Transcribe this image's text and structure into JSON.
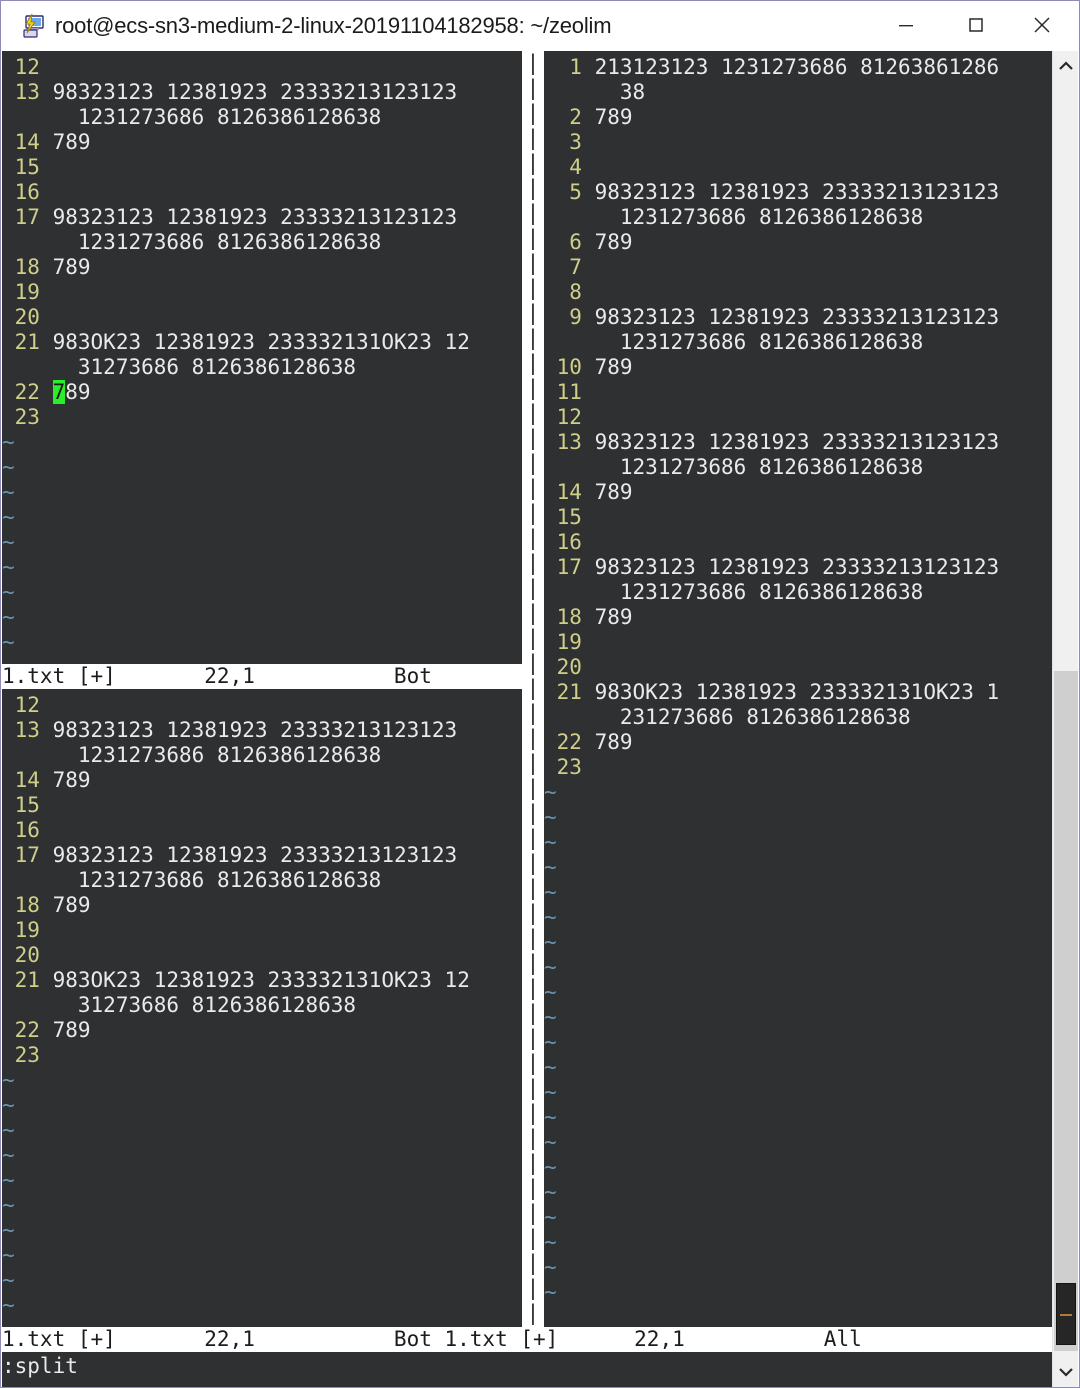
{
  "window": {
    "title": "root@ecs-sn3-medium-2-linux-20191104182958: ~/zeolim",
    "icon": "putty-icon",
    "controls": {
      "minimize": "minimize-icon",
      "maximize": "maximize-icon",
      "close": "close-icon"
    }
  },
  "editor": {
    "app": "vim",
    "command_line": ":split",
    "cursor": {
      "line": 22,
      "col": 1,
      "char": "7",
      "color": "#2bee2b"
    },
    "colors": {
      "background": "#2f3031",
      "foreground": "#eaeaea",
      "line_number": "#cfcf8a",
      "tilde": "#6a93b0",
      "statusline_bg": "#ffffff",
      "statusline_fg": "#1c1c1c"
    },
    "separator_char": "|"
  },
  "panes": [
    {
      "id": "top-left",
      "status": {
        "file": "1.txt",
        "modified": "[+]",
        "position": "22,1",
        "scroll": "Bot"
      },
      "rows": [
        {
          "num": "12",
          "text": ""
        },
        {
          "num": "13",
          "text": "98323123 12381923 23333213123123"
        },
        {
          "num": "",
          "text": "1231273686 8126386128638",
          "cont": true
        },
        {
          "num": "14",
          "text": "789"
        },
        {
          "num": "15",
          "text": ""
        },
        {
          "num": "16",
          "text": ""
        },
        {
          "num": "17",
          "text": "98323123 12381923 23333213123123"
        },
        {
          "num": "",
          "text": "1231273686 8126386128638",
          "cont": true
        },
        {
          "num": "18",
          "text": "789"
        },
        {
          "num": "19",
          "text": ""
        },
        {
          "num": "20",
          "text": ""
        },
        {
          "num": "21",
          "text": "983OK23 12381923 233332131OK23 12"
        },
        {
          "num": "",
          "text": "31273686 8126386128638",
          "cont": true
        },
        {
          "num": "22",
          "text": "789",
          "cursor": true
        },
        {
          "num": "23",
          "text": ""
        },
        {
          "num": "~",
          "text": ""
        },
        {
          "num": "~",
          "text": ""
        },
        {
          "num": "~",
          "text": ""
        },
        {
          "num": "~",
          "text": ""
        },
        {
          "num": "~",
          "text": ""
        },
        {
          "num": "~",
          "text": ""
        },
        {
          "num": "~",
          "text": ""
        },
        {
          "num": "~",
          "text": ""
        },
        {
          "num": "~",
          "text": ""
        },
        {
          "num": "~",
          "text": ""
        }
      ]
    },
    {
      "id": "bottom-left",
      "status": {
        "file": "1.txt",
        "modified": "[+]",
        "position": "22,1",
        "scroll": "Bot"
      },
      "rows": [
        {
          "num": "12",
          "text": ""
        },
        {
          "num": "13",
          "text": "98323123 12381923 23333213123123"
        },
        {
          "num": "",
          "text": "1231273686 8126386128638",
          "cont": true
        },
        {
          "num": "14",
          "text": "789"
        },
        {
          "num": "15",
          "text": ""
        },
        {
          "num": "16",
          "text": ""
        },
        {
          "num": "17",
          "text": "98323123 12381923 23333213123123"
        },
        {
          "num": "",
          "text": "1231273686 8126386128638",
          "cont": true
        },
        {
          "num": "18",
          "text": "789"
        },
        {
          "num": "19",
          "text": ""
        },
        {
          "num": "20",
          "text": ""
        },
        {
          "num": "21",
          "text": "983OK23 12381923 233332131OK23 12"
        },
        {
          "num": "",
          "text": "31273686 8126386128638",
          "cont": true
        },
        {
          "num": "22",
          "text": "789"
        },
        {
          "num": "23",
          "text": ""
        },
        {
          "num": "~",
          "text": ""
        },
        {
          "num": "~",
          "text": ""
        },
        {
          "num": "~",
          "text": ""
        },
        {
          "num": "~",
          "text": ""
        },
        {
          "num": "~",
          "text": ""
        },
        {
          "num": "~",
          "text": ""
        },
        {
          "num": "~",
          "text": ""
        },
        {
          "num": "~",
          "text": ""
        },
        {
          "num": "~",
          "text": ""
        },
        {
          "num": "~",
          "text": ""
        }
      ]
    },
    {
      "id": "right",
      "status": {
        "file": "1.txt",
        "modified": "[+]",
        "position": "22,1",
        "scroll": "All"
      },
      "rows": [
        {
          "num": " 1",
          "text": "213123123 1231273686 81263861286"
        },
        {
          "num": "",
          "text": "38",
          "cont": true
        },
        {
          "num": " 2",
          "text": "789"
        },
        {
          "num": " 3",
          "text": ""
        },
        {
          "num": " 4",
          "text": ""
        },
        {
          "num": " 5",
          "text": "98323123 12381923 23333213123123"
        },
        {
          "num": "",
          "text": "1231273686 8126386128638",
          "cont": true
        },
        {
          "num": " 6",
          "text": "789"
        },
        {
          "num": " 7",
          "text": ""
        },
        {
          "num": " 8",
          "text": ""
        },
        {
          "num": " 9",
          "text": "98323123 12381923 23333213123123"
        },
        {
          "num": "",
          "text": "1231273686 8126386128638",
          "cont": true
        },
        {
          "num": "10",
          "text": "789"
        },
        {
          "num": "11",
          "text": ""
        },
        {
          "num": "12",
          "text": ""
        },
        {
          "num": "13",
          "text": "98323123 12381923 23333213123123"
        },
        {
          "num": "",
          "text": "1231273686 8126386128638",
          "cont": true
        },
        {
          "num": "14",
          "text": "789"
        },
        {
          "num": "15",
          "text": ""
        },
        {
          "num": "16",
          "text": ""
        },
        {
          "num": "17",
          "text": "98323123 12381923 23333213123123"
        },
        {
          "num": "",
          "text": "1231273686 8126386128638",
          "cont": true
        },
        {
          "num": "18",
          "text": "789"
        },
        {
          "num": "19",
          "text": ""
        },
        {
          "num": "20",
          "text": ""
        },
        {
          "num": "21",
          "text": "983OK23 12381923 233332131OK23 1"
        },
        {
          "num": "",
          "text": "231273686 8126386128638",
          "cont": true
        },
        {
          "num": "22",
          "text": "789"
        },
        {
          "num": "23",
          "text": ""
        },
        {
          "num": "~",
          "text": ""
        },
        {
          "num": "~",
          "text": ""
        },
        {
          "num": "~",
          "text": ""
        },
        {
          "num": "~",
          "text": ""
        },
        {
          "num": "~",
          "text": ""
        },
        {
          "num": "~",
          "text": ""
        },
        {
          "num": "~",
          "text": ""
        },
        {
          "num": "~",
          "text": ""
        },
        {
          "num": "~",
          "text": ""
        },
        {
          "num": "~",
          "text": ""
        },
        {
          "num": "~",
          "text": ""
        },
        {
          "num": "~",
          "text": ""
        },
        {
          "num": "~",
          "text": ""
        },
        {
          "num": "~",
          "text": ""
        },
        {
          "num": "~",
          "text": ""
        },
        {
          "num": "~",
          "text": ""
        },
        {
          "num": "~",
          "text": ""
        },
        {
          "num": "~",
          "text": ""
        },
        {
          "num": "~",
          "text": ""
        },
        {
          "num": "~",
          "text": ""
        },
        {
          "num": "~",
          "text": ""
        }
      ]
    }
  ],
  "scrollbar": {
    "up_arrow": "chevron-up-icon",
    "down_arrow": "chevron-down-icon"
  }
}
